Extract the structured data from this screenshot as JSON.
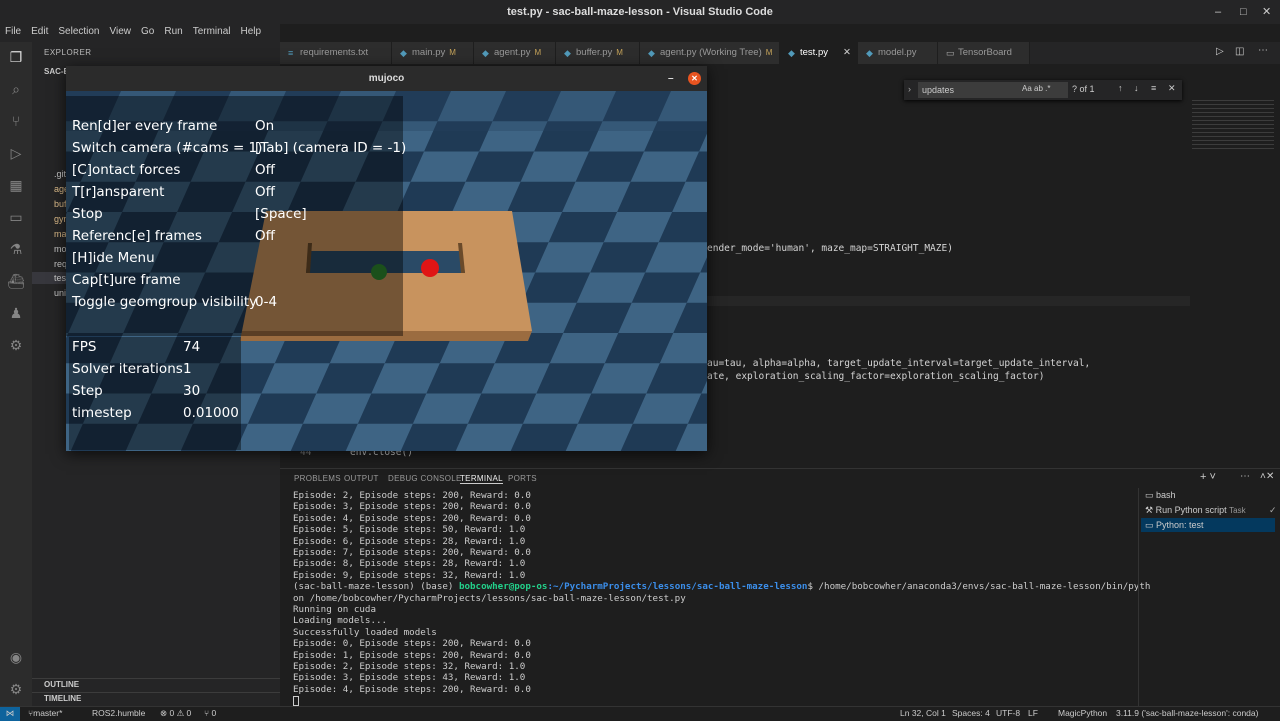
{
  "window": {
    "title": "test.py - sac-ball-maze-lesson - Visual Studio Code",
    "min": "–",
    "max": "□",
    "close": "✕"
  },
  "menu": [
    "File",
    "Edit",
    "Selection",
    "View",
    "Go",
    "Run",
    "Terminal",
    "Help"
  ],
  "sidebar": {
    "title": "EXPLORER",
    "folder": "SAC-BA",
    "items": [
      ".git",
      "age",
      "buf",
      "gyr",
      "ma",
      "mo",
      "req",
      "tes",
      "uni"
    ],
    "outline": "OUTLINE",
    "timeline": "TIMELINE"
  },
  "tabs": [
    {
      "label": "requirements.txt",
      "mod": ""
    },
    {
      "label": "main.py",
      "mod": "M"
    },
    {
      "label": "agent.py",
      "mod": "M"
    },
    {
      "label": "buffer.py",
      "mod": "M"
    },
    {
      "label": "agent.py (Working Tree)",
      "mod": "M"
    },
    {
      "label": "test.py",
      "mod": ""
    },
    {
      "label": "model.py",
      "mod": ""
    },
    {
      "label": "TensorBoard",
      "mod": ""
    }
  ],
  "find": {
    "value": "updates",
    "opts": "Aa  ab  .*",
    "count": "? of 1",
    "up": "↑",
    "down": "↓",
    "close": "✕"
  },
  "code": {
    "line1": "ender_mode='human', maze_map=STRAIGHT_MAZE)",
    "line2": "au=tau, alpha=alpha, target_update_interval=target_update_interval,",
    "line3": "ate, exploration_scaling_factor=exploration_scaling_factor)",
    "line4": "env.close()",
    "lineno": "44"
  },
  "panel": {
    "tabs": [
      "PROBLEMS",
      "OUTPUT",
      "DEBUG CONSOLE",
      "TERMINAL",
      "PORTS"
    ],
    "lines": [
      "Episode: 2, Episode steps: 200, Reward: 0.0",
      "Episode: 3, Episode steps: 200, Reward: 0.0",
      "Episode: 4, Episode steps: 200, Reward: 0.0",
      "Episode: 5, Episode steps: 50, Reward: 1.0",
      "Episode: 6, Episode steps: 28, Reward: 1.0",
      "Episode: 7, Episode steps: 200, Reward: 0.0",
      "Episode: 8, Episode steps: 28, Reward: 1.0",
      "Episode: 9, Episode steps: 32, Reward: 1.0"
    ],
    "prompt_env": "(sac-ball-maze-lesson) (base) ",
    "prompt_user": "bobcowher@pop-os",
    "prompt_path": ":~/PycharmProjects/lessons/sac-ball-maze-lesson",
    "prompt_cmd": "$ /home/bobcowher/anaconda3/envs/sac-ball-maze-lesson/bin/pyth",
    "prompt_cont": "on /home/bobcowher/PycharmProjects/lessons/sac-ball-maze-lesson/test.py",
    "lines2": [
      "Running on cuda",
      "Loading models...",
      "Successfully loaded models",
      "Episode: 0, Episode steps: 200, Reward: 0.0",
      "Episode: 1, Episode steps: 200, Reward: 0.0",
      "Episode: 2, Episode steps: 32, Reward: 1.0",
      "Episode: 3, Episode steps: 43, Reward: 1.0",
      "Episode: 4, Episode steps: 200, Reward: 0.0"
    ],
    "terminals": [
      "bash",
      "Run Python script",
      "Python: test"
    ],
    "task_badge": "Task"
  },
  "status": {
    "branch": "master*",
    "ros": "ROS2.humble",
    "problems": "⊗ 0 ⚠ 0",
    "ports": "⑂ 0",
    "pos": "Ln 32, Col 1",
    "spaces": "Spaces: 4",
    "enc": "UTF-8",
    "eol": "LF",
    "lang": "MagicPython",
    "interp": "3.11.9 ('sac-ball-maze-lesson': conda)"
  },
  "mujoco": {
    "title": "mujoco",
    "menu": [
      {
        "k": "Ren[d]er every frame",
        "v": "On"
      },
      {
        "k": "Switch camera (#cams = 1)",
        "v": "[Tab] (camera ID = -1)"
      },
      {
        "k": "[C]ontact forces",
        "v": "Off"
      },
      {
        "k": "T[r]ansparent",
        "v": "Off"
      },
      {
        "k": "Stop",
        "v": "[Space]"
      },
      {
        "k": "Referenc[e] frames",
        "v": "Off"
      },
      {
        "k": "[H]ide Menu",
        "v": ""
      },
      {
        "k": "Cap[t]ure frame",
        "v": ""
      },
      {
        "k": "Toggle geomgroup visibility",
        "v": "0-4"
      }
    ],
    "stats": [
      {
        "k": "FPS",
        "v": "74"
      },
      {
        "k": "Solver iterations",
        "v": "1"
      },
      {
        "k": "Step",
        "v": "30"
      },
      {
        "k": "timestep",
        "v": "0.01000"
      }
    ],
    "colors": {
      "floor_dark": "#1f3a55",
      "floor_light": "#3e6484",
      "maze": "#c8935e",
      "ball_red": "#e01515",
      "ball_green": "#2f8a2f"
    }
  }
}
